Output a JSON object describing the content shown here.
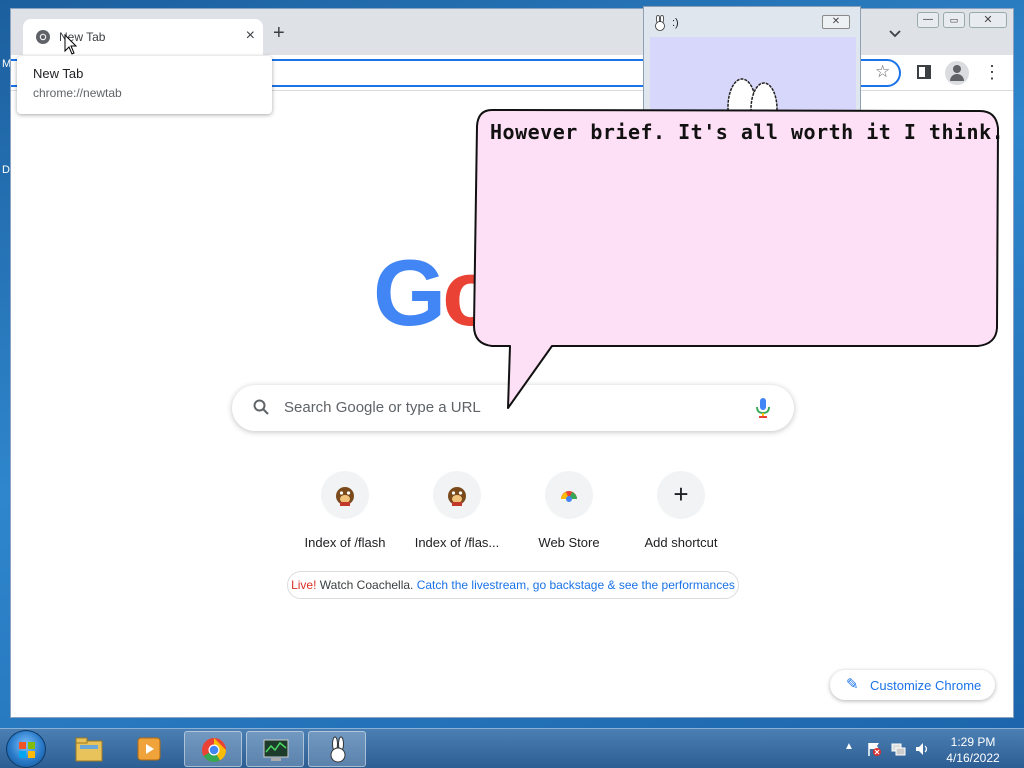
{
  "desktop": {
    "edge_letters": [
      "M",
      "D"
    ]
  },
  "browser": {
    "tab": {
      "title": "New Tab"
    },
    "new_tab_symbol": "+",
    "hovercard": {
      "title": "New Tab",
      "url": "chrome://newtab"
    },
    "window_controls": {
      "minimize": "—",
      "maximize": "▭",
      "close": "✕"
    }
  },
  "ntp": {
    "logo_visible": "Go",
    "search_placeholder": "Search Google or type a URL",
    "shortcuts": [
      {
        "label": "Index of /flash",
        "icon": "mole-icon"
      },
      {
        "label": "Index of /flas...",
        "icon": "mole-icon"
      },
      {
        "label": "Web Store",
        "icon": "web-store-icon"
      },
      {
        "label": "Add shortcut",
        "icon": "plus-icon"
      }
    ],
    "promo": {
      "live": "Live!",
      "text": " Watch Coachella. ",
      "link": "Catch the livestream, go backstage & see the performances"
    },
    "customize_label": "Customize Chrome"
  },
  "bunny_window": {
    "title": ":)",
    "bubble_text": "However brief. It's all worth it I think."
  },
  "taskbar": {
    "clock_time": "1:29 PM",
    "clock_date": "4/16/2022",
    "tray_arrow": "▲"
  },
  "colors": {
    "google_blue": "#4285f4",
    "google_red": "#ea4335",
    "bubble_fill": "#fde0f5",
    "chrome_accent": "#1a73e8"
  }
}
